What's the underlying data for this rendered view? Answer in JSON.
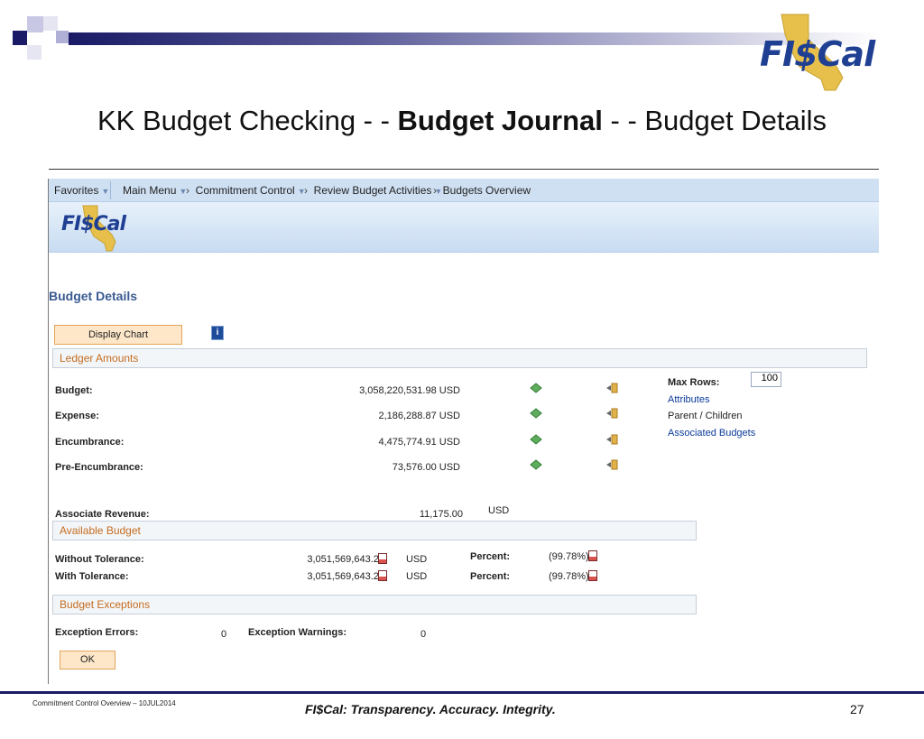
{
  "slide": {
    "logo_text": "FI$Cal",
    "title_pre": "KK Budget Checking - - ",
    "title_bold": "Budget Journal",
    "title_post": " - - Budget Details"
  },
  "navbar": {
    "favorites": "Favorites",
    "main_menu": "Main Menu",
    "breadcrumb_1": "Commitment Control",
    "breadcrumb_2": "Review Budget Activities",
    "breadcrumb_3": "Budgets Overview"
  },
  "app_logo_text": "FI$Cal",
  "page_title": "Budget Details",
  "buttons": {
    "display_chart": "Display Chart",
    "ok": "OK"
  },
  "ledger": {
    "section_title": "Ledger Amounts",
    "rows": [
      {
        "label": "Budget:",
        "amount": "3,058,220,531.98",
        "currency": "USD"
      },
      {
        "label": "Expense:",
        "amount": "2,186,288.87",
        "currency": "USD"
      },
      {
        "label": "Encumbrance:",
        "amount": "4,475,774.91",
        "currency": "USD"
      },
      {
        "label": "Pre-Encumbrance:",
        "amount": "73,576.00",
        "currency": "USD"
      }
    ],
    "associate_revenue_label": "Associate Revenue:",
    "associate_revenue_amount": "11,175.00",
    "associate_revenue_currency": "USD"
  },
  "side_panel": {
    "max_rows_label": "Max Rows:",
    "max_rows_value": "100",
    "attributes": "Attributes",
    "parent_children": "Parent / Children",
    "associated_budgets": "Associated Budgets"
  },
  "available": {
    "section_title": "Available Budget",
    "rows": [
      {
        "label": "Without Tolerance:",
        "amount": "3,051,569,643.20",
        "currency": "USD",
        "percent_label": "Percent:",
        "percent": "(99.78%)"
      },
      {
        "label": "With Tolerance:",
        "amount": "3,051,569,643.20",
        "currency": "USD",
        "percent_label": "Percent:",
        "percent": "(99.78%)"
      }
    ]
  },
  "exceptions": {
    "section_title": "Budget Exceptions",
    "errors_label": "Exception Errors:",
    "errors_value": "0",
    "warnings_label": "Exception Warnings:",
    "warnings_value": "0"
  },
  "footer": {
    "left": "Commitment Control Overview – 10JUL2014",
    "center": "FI$Cal:  Transparency.  Accuracy.  Integrity.",
    "page_number": "27"
  },
  "colors": {
    "accent_navy": "#1a1a66",
    "logo_blue": "#1f3f93",
    "logo_gold": "#e6c04a",
    "section_orange": "#c46c1f",
    "link_blue": "#0b3a9a"
  }
}
